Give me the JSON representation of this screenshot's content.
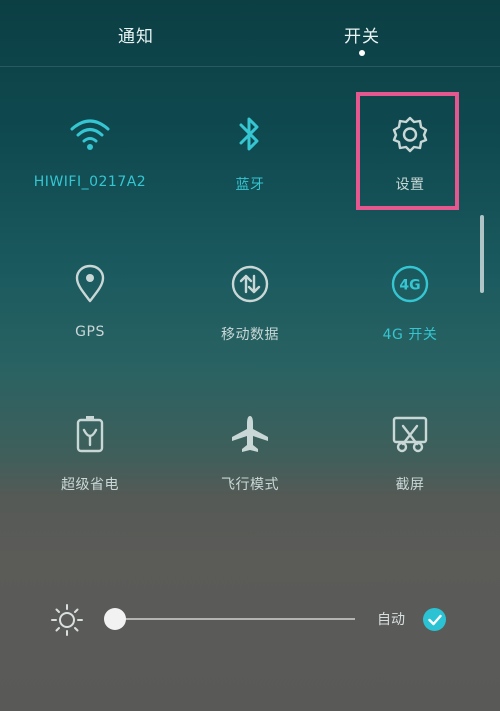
{
  "tabs": {
    "notifications_label": "通知",
    "switches_label": "开关",
    "selected": "开关"
  },
  "toggles": [
    {
      "label": "HIWIFI_0217A2",
      "icon": "wifi-icon",
      "active": true
    },
    {
      "label": "蓝牙",
      "icon": "bluetooth-icon",
      "active": true
    },
    {
      "label": "设置",
      "icon": "gear-icon",
      "active": false
    },
    {
      "label": "GPS",
      "icon": "location-pin-icon",
      "active": false
    },
    {
      "label": "移动数据",
      "icon": "mobile-data-icon",
      "active": false
    },
    {
      "label": "4G 开关",
      "icon": "4g-icon",
      "active": true
    },
    {
      "label": "超级省电",
      "icon": "battery-saver-icon",
      "active": false
    },
    {
      "label": "飞行模式",
      "icon": "airplane-icon",
      "active": false
    },
    {
      "label": "截屏",
      "icon": "screenshot-icon",
      "active": false
    }
  ],
  "brightness": {
    "auto_label": "自动",
    "auto_enabled": true,
    "level": 0.0
  },
  "colors": {
    "accent": "#35c6d2",
    "highlight": "#e4588f"
  }
}
